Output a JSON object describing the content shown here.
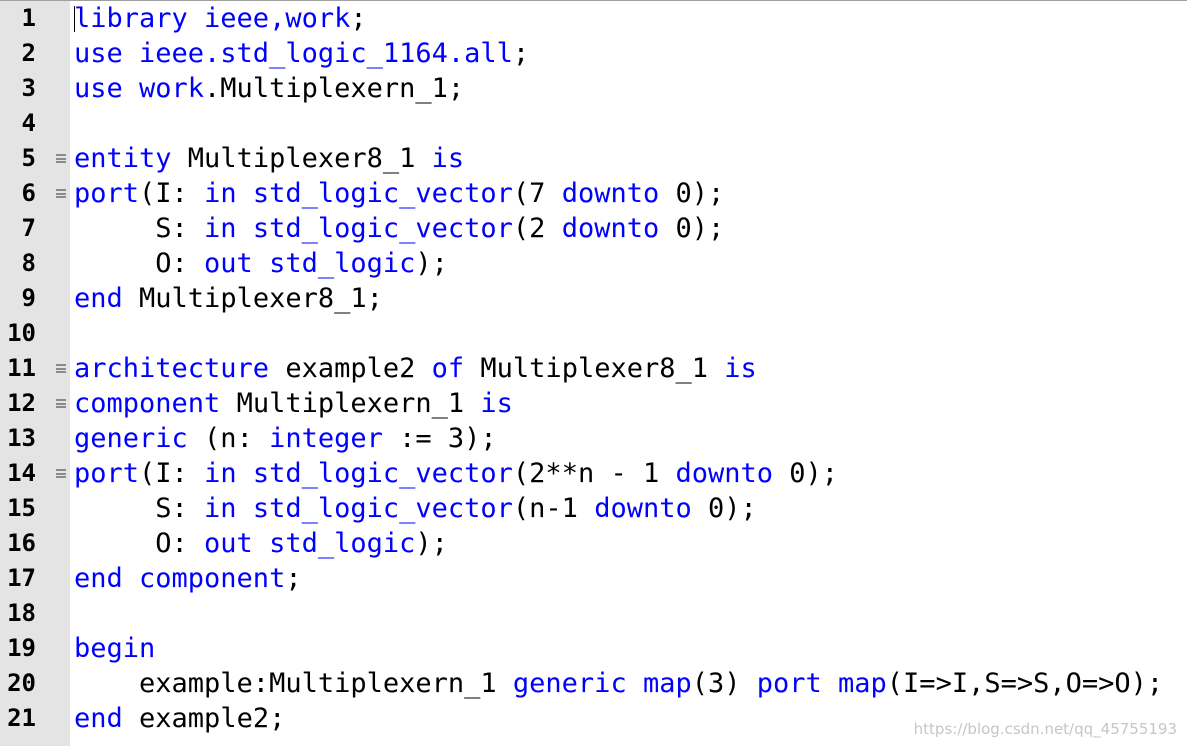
{
  "editor": {
    "language": "VHDL",
    "colors": {
      "keyword": "#0000ff",
      "text": "#000000",
      "gutter_background": "#e4e4e4",
      "fold_marker": "#8a8a8a",
      "watermark": "#c6c6c6"
    },
    "lines": [
      {
        "number": "1",
        "fold": false,
        "tokens": [
          {
            "t": "library ieee,work",
            "k": true
          },
          {
            "t": ";",
            "k": false
          }
        ]
      },
      {
        "number": "2",
        "fold": false,
        "tokens": [
          {
            "t": "use ieee.std_logic_1164.all",
            "k": true
          },
          {
            "t": ";",
            "k": false
          }
        ]
      },
      {
        "number": "3",
        "fold": false,
        "tokens": [
          {
            "t": "use work",
            "k": true
          },
          {
            "t": ".Multiplexern_1;",
            "k": false
          }
        ]
      },
      {
        "number": "4",
        "fold": false,
        "tokens": []
      },
      {
        "number": "5",
        "fold": true,
        "tokens": [
          {
            "t": "entity",
            "k": true
          },
          {
            "t": " Multiplexer8_1 ",
            "k": false
          },
          {
            "t": "is",
            "k": true
          }
        ]
      },
      {
        "number": "6",
        "fold": true,
        "tokens": [
          {
            "t": "port",
            "k": true
          },
          {
            "t": "(I: ",
            "k": false
          },
          {
            "t": "in std_logic_vector",
            "k": true
          },
          {
            "t": "(7 ",
            "k": false
          },
          {
            "t": "downto",
            "k": true
          },
          {
            "t": " 0);",
            "k": false
          }
        ]
      },
      {
        "number": "7",
        "fold": false,
        "tokens": [
          {
            "t": "     S: ",
            "k": false
          },
          {
            "t": "in std_logic_vector",
            "k": true
          },
          {
            "t": "(2 ",
            "k": false
          },
          {
            "t": "downto",
            "k": true
          },
          {
            "t": " 0);",
            "k": false
          }
        ]
      },
      {
        "number": "8",
        "fold": false,
        "tokens": [
          {
            "t": "     O: ",
            "k": false
          },
          {
            "t": "out std_logic",
            "k": true
          },
          {
            "t": ");",
            "k": false
          }
        ]
      },
      {
        "number": "9",
        "fold": false,
        "tokens": [
          {
            "t": "end",
            "k": true
          },
          {
            "t": " Multiplexer8_1;",
            "k": false
          }
        ]
      },
      {
        "number": "10",
        "fold": false,
        "tokens": []
      },
      {
        "number": "11",
        "fold": true,
        "tokens": [
          {
            "t": "architecture",
            "k": true
          },
          {
            "t": " example2 ",
            "k": false
          },
          {
            "t": "of",
            "k": true
          },
          {
            "t": " Multiplexer8_1 ",
            "k": false
          },
          {
            "t": "is",
            "k": true
          }
        ]
      },
      {
        "number": "12",
        "fold": true,
        "tokens": [
          {
            "t": "component",
            "k": true
          },
          {
            "t": " Multiplexern_1 ",
            "k": false
          },
          {
            "t": "is",
            "k": true
          }
        ]
      },
      {
        "number": "13",
        "fold": false,
        "tokens": [
          {
            "t": "generic",
            "k": true
          },
          {
            "t": " (n: ",
            "k": false
          },
          {
            "t": "integer",
            "k": true
          },
          {
            "t": " := 3);",
            "k": false
          }
        ]
      },
      {
        "number": "14",
        "fold": true,
        "tokens": [
          {
            "t": "port",
            "k": true
          },
          {
            "t": "(I: ",
            "k": false
          },
          {
            "t": "in std_logic_vector",
            "k": true
          },
          {
            "t": "(2**n - 1 ",
            "k": false
          },
          {
            "t": "downto",
            "k": true
          },
          {
            "t": " 0);",
            "k": false
          }
        ]
      },
      {
        "number": "15",
        "fold": false,
        "tokens": [
          {
            "t": "     S: ",
            "k": false
          },
          {
            "t": "in std_logic_vector",
            "k": true
          },
          {
            "t": "(n-1 ",
            "k": false
          },
          {
            "t": "downto",
            "k": true
          },
          {
            "t": " 0);",
            "k": false
          }
        ]
      },
      {
        "number": "16",
        "fold": false,
        "tokens": [
          {
            "t": "     O: ",
            "k": false
          },
          {
            "t": "out std_logic",
            "k": true
          },
          {
            "t": ");",
            "k": false
          }
        ]
      },
      {
        "number": "17",
        "fold": false,
        "tokens": [
          {
            "t": "end component",
            "k": true
          },
          {
            "t": ";",
            "k": false
          }
        ]
      },
      {
        "number": "18",
        "fold": false,
        "tokens": []
      },
      {
        "number": "19",
        "fold": false,
        "tokens": [
          {
            "t": "begin",
            "k": true
          }
        ]
      },
      {
        "number": "20",
        "fold": false,
        "tokens": [
          {
            "t": "    example:Multiplexern_1 ",
            "k": false
          },
          {
            "t": "generic map",
            "k": true
          },
          {
            "t": "(3) ",
            "k": false
          },
          {
            "t": "port map",
            "k": true
          },
          {
            "t": "(I=>I,S=>S,O=>O);",
            "k": false
          }
        ]
      },
      {
        "number": "21",
        "fold": false,
        "tokens": [
          {
            "t": "end",
            "k": true
          },
          {
            "t": " example2;",
            "k": false
          }
        ]
      }
    ]
  },
  "watermark": "https://blog.csdn.net/qq_45755193"
}
